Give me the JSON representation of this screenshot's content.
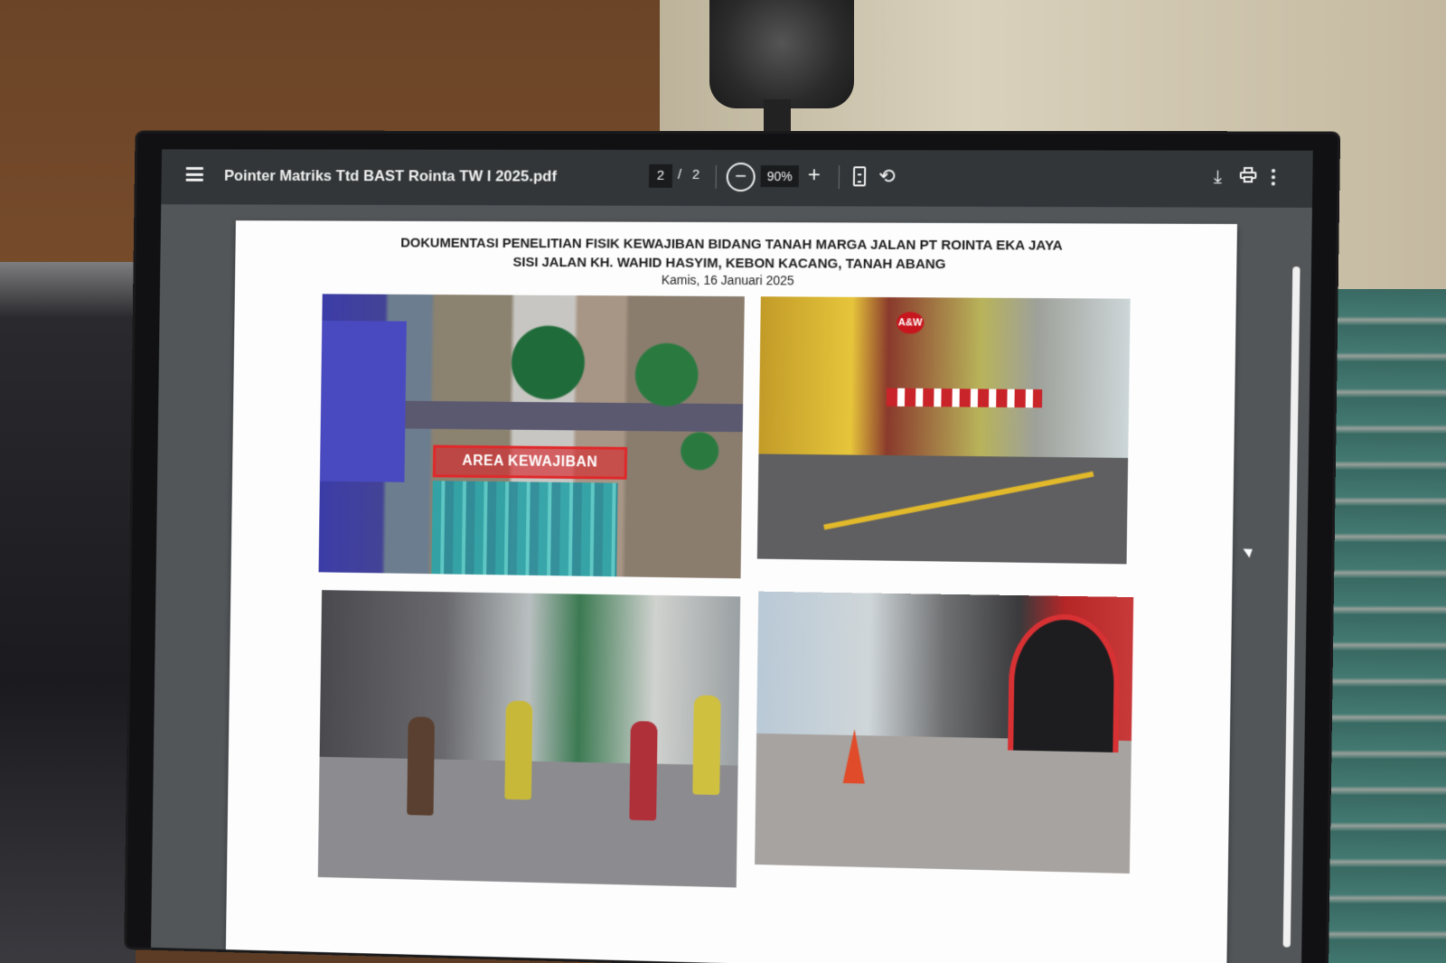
{
  "viewer": {
    "file_title": "Pointer Matriks Ttd BAST Rointa TW I 2025.pdf",
    "current_page": "2",
    "page_separator": "/",
    "total_pages": "2",
    "zoom": "90%",
    "zoom_out_label": "−",
    "zoom_in_label": "+",
    "rotate_label": "⟲",
    "download_label": "⤓"
  },
  "document": {
    "title_line1": "DOKUMENTASI PENELITIAN FISIK KEWAJIBAN BIDANG TANAH MARGA JALAN PT ROINTA EKA JAYA",
    "title_line2": "SISI JALAN KH. WAHID HASYIM, KEBON KACANG, TANAH ABANG",
    "date": "Kamis, 16 Januari 2025",
    "aerial_label": "AREA KEWAJIBAN",
    "store_sign": "A&W"
  },
  "icons": [
    "menu-icon",
    "zoom-out-icon",
    "zoom-in-icon",
    "fit-page-icon",
    "rotate-icon",
    "download-icon",
    "print-icon",
    "more-icon"
  ],
  "colors": {
    "toolbar": "#323639",
    "viewer_bg": "#525659",
    "label_red": "#e0282a"
  }
}
